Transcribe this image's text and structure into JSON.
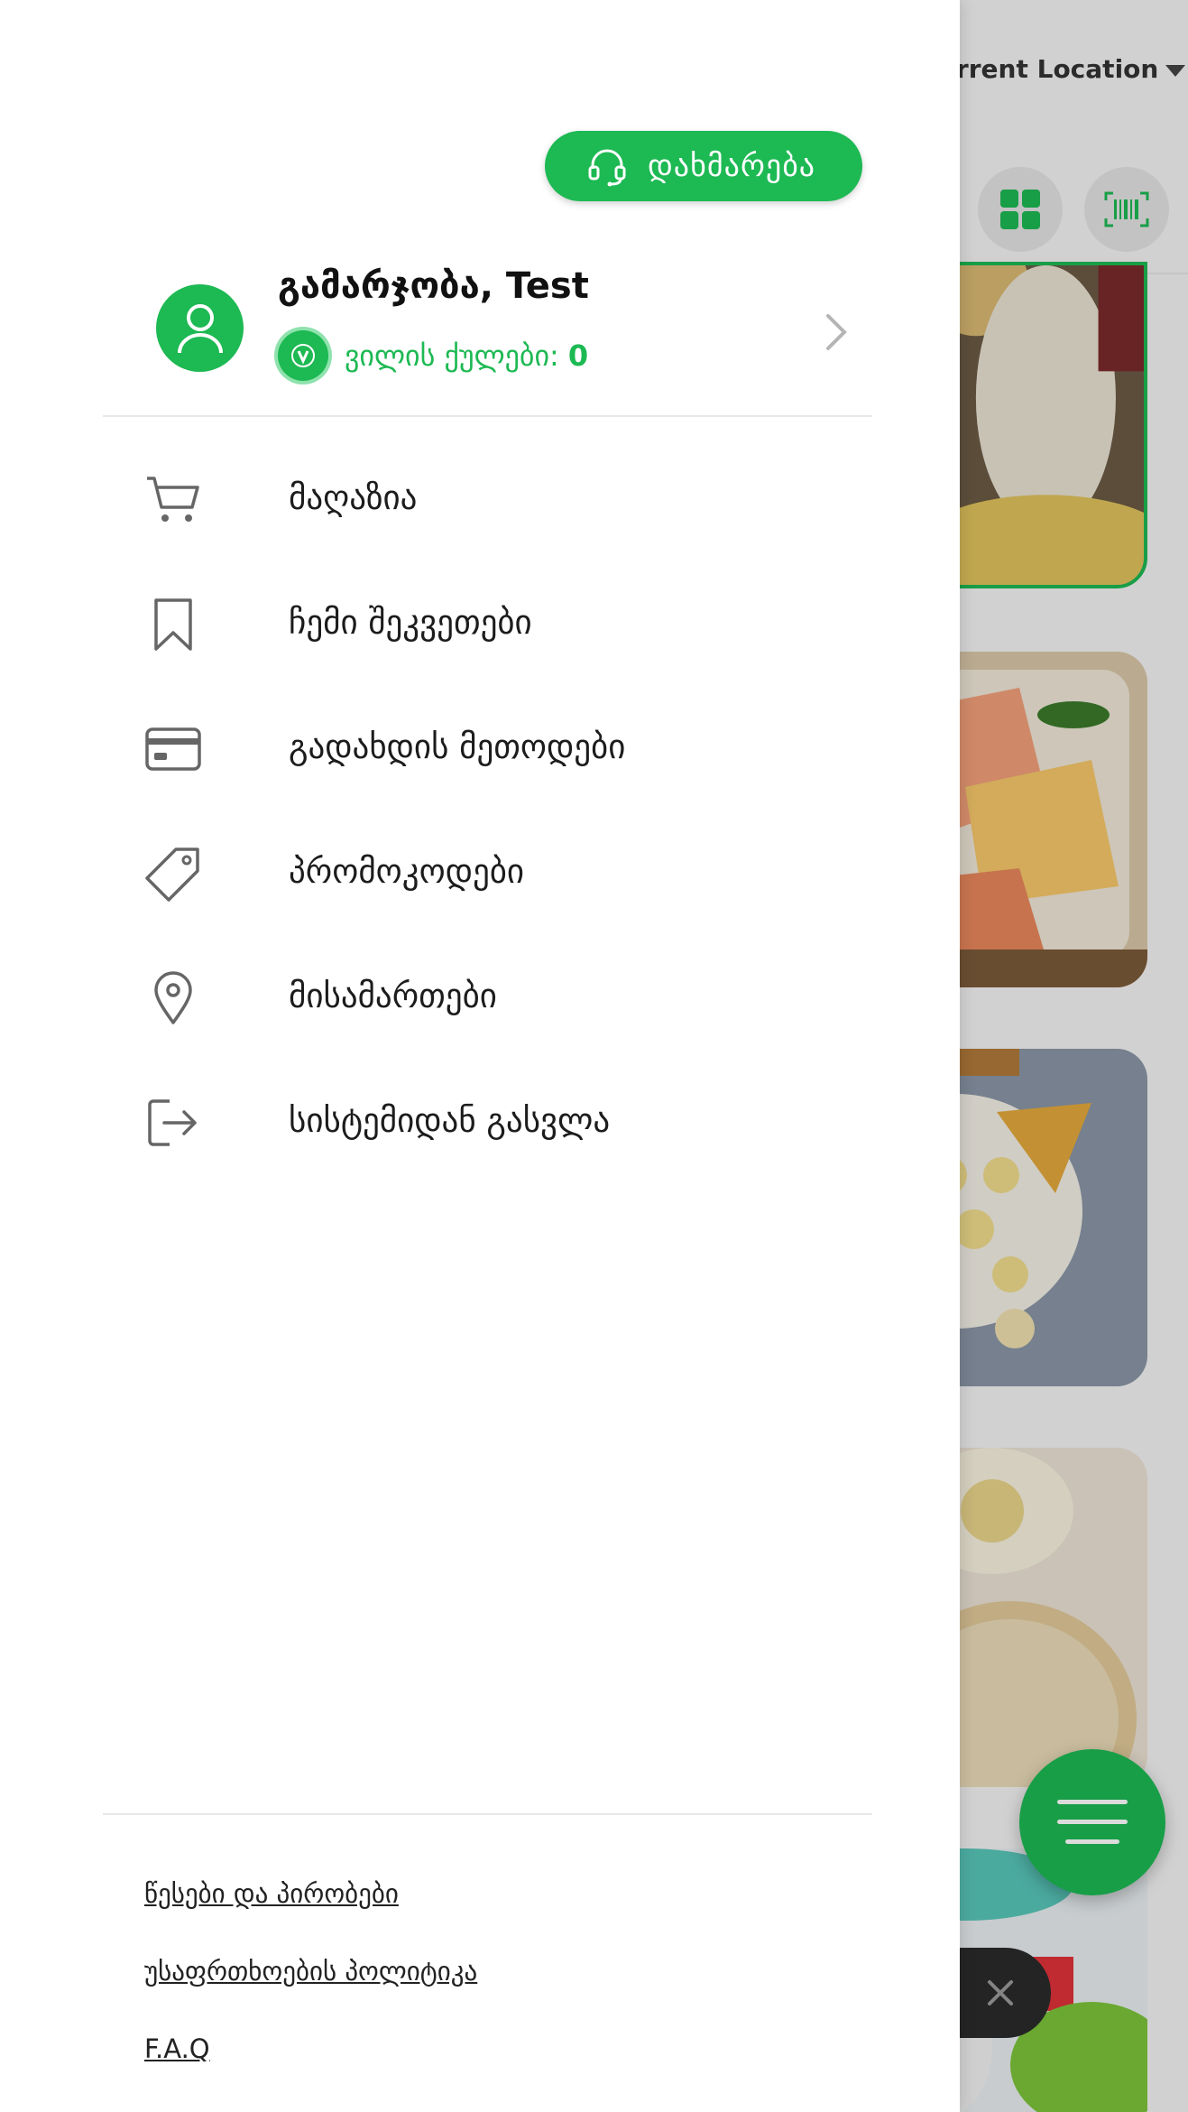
{
  "background_app": {
    "location_label": "urrent Location",
    "icons": [
      "grid-icon",
      "barcode-icon",
      "menu-icon",
      "close-icon"
    ]
  },
  "drawer": {
    "help_button": {
      "label": "დახმარება",
      "icon": "headset-icon"
    },
    "profile": {
      "greeting": "გამარჯობა, Test",
      "points_label": "ვილის ქულები:",
      "points_value": "0"
    },
    "menu": [
      {
        "label": "მაღაზია",
        "icon": "cart-icon"
      },
      {
        "label": "ჩემი შეკვეთები",
        "icon": "bookmark-icon"
      },
      {
        "label": "გადახდის მეთოდები",
        "icon": "credit-card-icon"
      },
      {
        "label": "პრომოკოდები",
        "icon": "tag-icon"
      },
      {
        "label": "მისამართები",
        "icon": "location-pin-icon"
      },
      {
        "label": "სისტემიდან გასვლა",
        "icon": "logout-icon"
      }
    ],
    "footer_links": [
      {
        "label": "წესები და პირობები"
      },
      {
        "label": "უსაფრთხოების პოლიტიკა"
      },
      {
        "label": "F.A.Q"
      }
    ]
  },
  "colors": {
    "accent": "#1db953",
    "text": "#1c1c1c",
    "icon_gray": "#666666"
  }
}
